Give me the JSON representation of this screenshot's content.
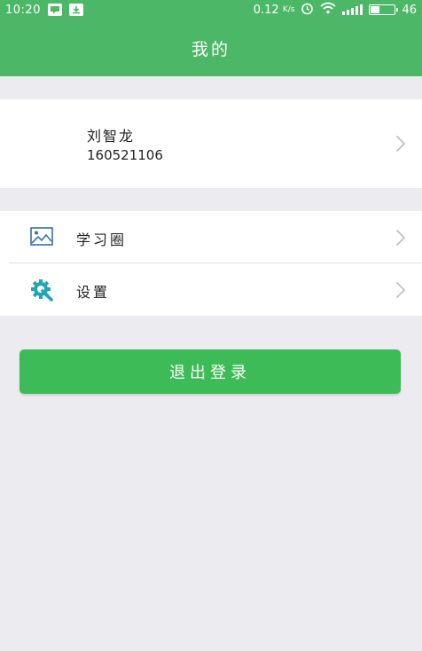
{
  "status_bar": {
    "time": "10:20",
    "network_speed": "0.12",
    "network_speed_unit": "K/s",
    "battery_level": "46",
    "icons": [
      "message-app-icon",
      "download-app-icon",
      "alarm-icon",
      "wifi-icon",
      "signal-icon",
      "battery-icon"
    ]
  },
  "header": {
    "title": "我的"
  },
  "profile": {
    "name": "刘智龙",
    "student_id": "160521106"
  },
  "menu": {
    "items": [
      {
        "label": "学习圈",
        "icon": "image-icon",
        "icon_color": "#3a6fa8"
      },
      {
        "label": "设置",
        "icon": "gear-wrench-icon",
        "icon_color": "#21a5b5"
      }
    ]
  },
  "logout": {
    "label": "退出登录"
  },
  "colors": {
    "header_green": "#4cb766",
    "button_green": "#3dbb56",
    "background": "#ebebf0"
  }
}
